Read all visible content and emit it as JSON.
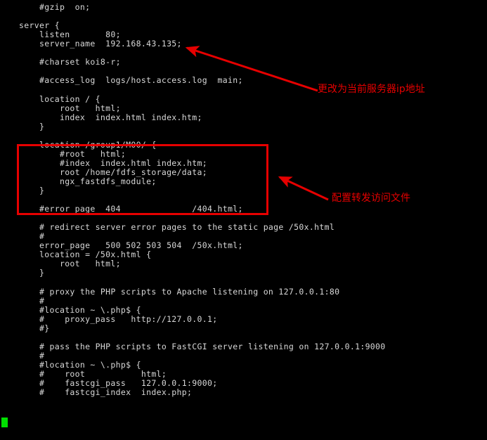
{
  "terminal": {
    "background_color": "#000000",
    "text_color": "#d8d8d8",
    "cursor_color": "#00e000",
    "accent_color": "#e60000",
    "lines": [
      "    #gzip  on;",
      "",
      "server {",
      "    listen       80;",
      "    server_name  192.168.43.135;",
      "",
      "    #charset koi8-r;",
      "",
      "    #access_log  logs/host.access.log  main;",
      "",
      "    location / {",
      "        root   html;",
      "        index  index.html index.htm;",
      "    }",
      "",
      "    location /group1/M00/ {",
      "        #root   html;",
      "        #index  index.html index.htm;",
      "        root /home/fdfs_storage/data;",
      "        ngx_fastdfs_module;",
      "    }",
      "",
      "    #error_page  404              /404.html;",
      "",
      "    # redirect server error pages to the static page /50x.html",
      "    #",
      "    error_page   500 502 503 504  /50x.html;",
      "    location = /50x.html {",
      "        root   html;",
      "    }",
      "",
      "    # proxy the PHP scripts to Apache listening on 127.0.0.1:80",
      "    #",
      "    #location ~ \\.php$ {",
      "    #    proxy_pass   http://127.0.0.1;",
      "    #}",
      "",
      "    # pass the PHP scripts to FastCGI server listening on 127.0.0.1:9000",
      "    #",
      "    #location ~ \\.php$ {",
      "    #    root           html;",
      "    #    fastcgi_pass   127.0.0.1:9000;",
      "    #    fastcgi_index  index.php;"
    ]
  },
  "annotations": {
    "ip_note": {
      "text": "更改为当前服务器ip地址",
      "color": "#e60000"
    },
    "forward_note": {
      "text": "配置转发访问文件",
      "color": "#e60000"
    }
  },
  "highlight": {
    "label": "location-group1-m00-block",
    "color": "#e60000"
  }
}
